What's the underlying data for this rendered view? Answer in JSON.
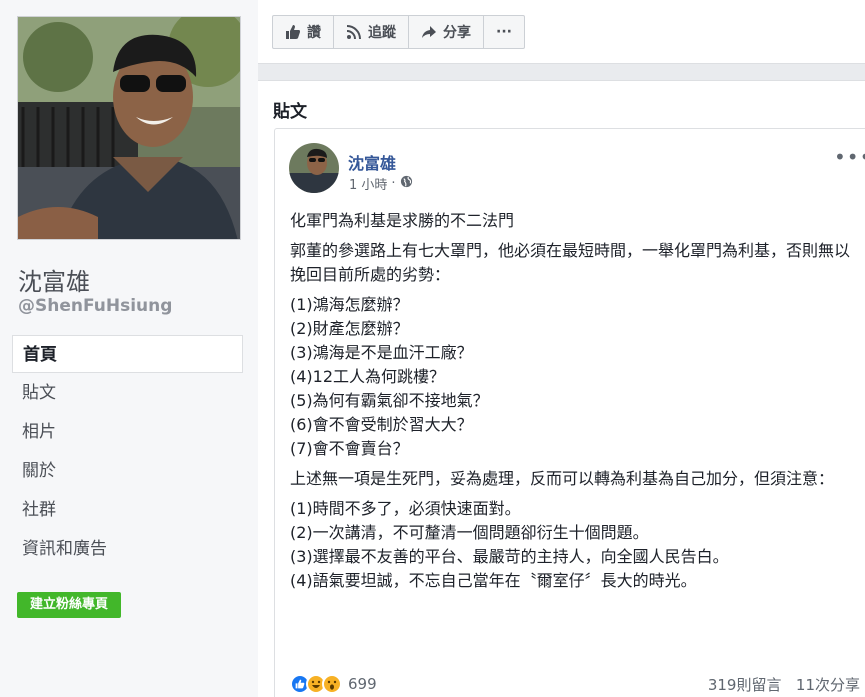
{
  "profile": {
    "name": "沈富雄",
    "handle": "@ShenFuHsiung"
  },
  "nav": {
    "items": [
      {
        "label": "首頁"
      },
      {
        "label": "貼文"
      },
      {
        "label": "相片"
      },
      {
        "label": "關於"
      },
      {
        "label": "社群"
      },
      {
        "label": "資訊和廣告"
      }
    ],
    "create_page_label": "建立粉絲專頁"
  },
  "actions": {
    "like": "讚",
    "follow": "追蹤",
    "share": "分享",
    "more": "···"
  },
  "posts_section": {
    "title": "貼文"
  },
  "post": {
    "author": "沈富雄",
    "time": "1 小時",
    "dot": "·",
    "more": "•••",
    "headline": "化軍門為利基是求勝的不二法門",
    "intro": "郭董的參選路上有七大罩門，他必須在最短時間，一舉化罩門為利基，否則無以挽回目前所處的劣勢：",
    "questions": [
      "(1)鴻海怎麼辦？",
      "(2)財產怎麼辦？",
      "(3)鴻海是不是血汗工廠？",
      "(4)12工人為何跳樓？",
      "(5)為何有霸氣卻不接地氣？",
      "(6)會不會受制於習大大？",
      "(7)會不會賣台？"
    ],
    "middle": "上述無一項是生死門，妥為處理，反而可以轉為利基為自己加分，但須注意：",
    "notes": [
      "(1)時間不多了，必須快速面對。",
      "(2)一次講清，不可釐清一個問題卻衍生十個問題。",
      "(3)選擇最不友善的平台、最嚴苛的主持人，向全國人民告白。",
      "(4)語氣要坦誠，不忘自己當年在〝爾室仔〞長大的時光。"
    ],
    "reaction_count": "699",
    "comments": "319則留言",
    "shares": "11次分享"
  },
  "colors": {
    "accent_link": "#365899",
    "create_button": "#42b72a"
  }
}
